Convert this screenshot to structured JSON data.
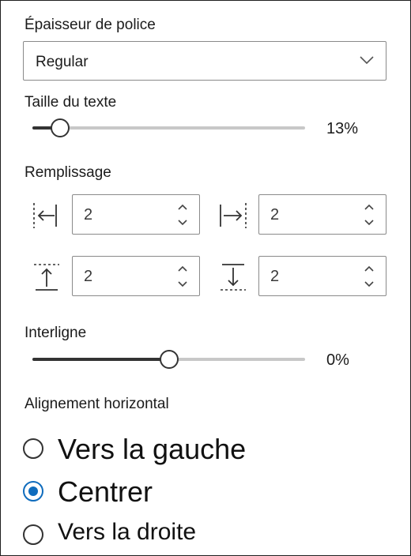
{
  "font_weight": {
    "label": "Épaisseur de police",
    "selected": "Regular",
    "icon": "chevron-down-icon"
  },
  "text_size": {
    "label": "Taille du texte",
    "value_text": "13%",
    "level": 0.1
  },
  "padding": {
    "label": "Remplissage",
    "left": {
      "icon": "padding-left-icon",
      "value": "2"
    },
    "right": {
      "icon": "padding-right-icon",
      "value": "2"
    },
    "top": {
      "icon": "padding-top-icon",
      "value": "2"
    },
    "bottom": {
      "icon": "padding-bottom-icon",
      "value": "2"
    }
  },
  "line_spacing": {
    "label": "Interligne",
    "value_text": "0%",
    "level": 0.5
  },
  "alignment": {
    "label": "Alignement horizontal",
    "options": [
      {
        "label": "Vers la gauche",
        "selected": false
      },
      {
        "label": "Centrer",
        "selected": true
      },
      {
        "label": "Vers la droite",
        "selected": false
      }
    ]
  },
  "colors": {
    "accent": "#0f6cbd",
    "slider_fill": "#333333",
    "slider_track": "#c8c8c8",
    "border": "#8a8a8a"
  }
}
